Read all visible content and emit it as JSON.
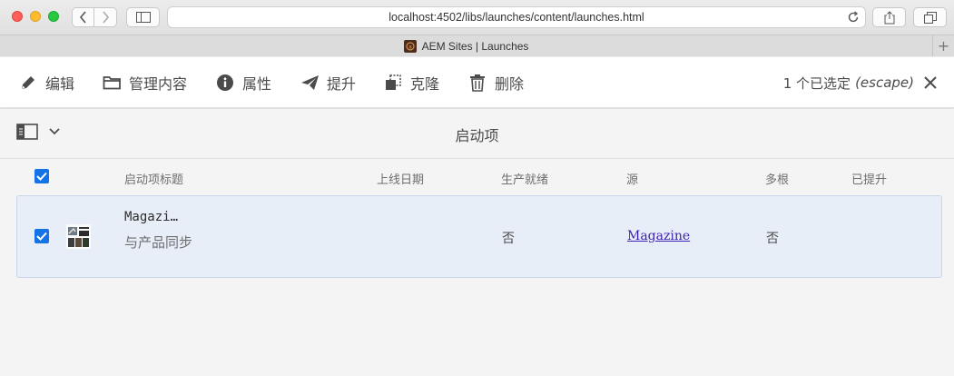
{
  "browser": {
    "url": "localhost:4502/libs/launches/content/launches.html",
    "tab_title": "AEM Sites | Launches",
    "new_tab_label": "+"
  },
  "actions": [
    {
      "label": "编辑",
      "icon": "pencil-icon"
    },
    {
      "label": "管理内容",
      "icon": "folder-icon"
    },
    {
      "label": "属性",
      "icon": "info-icon"
    },
    {
      "label": "提升",
      "icon": "send-icon"
    },
    {
      "label": "克隆",
      "icon": "duplicate-icon"
    },
    {
      "label": "删除",
      "icon": "trash-icon"
    }
  ],
  "selection": {
    "count_label": "1 个已选定",
    "escape_label": "(escape)"
  },
  "page": {
    "title": "启动项"
  },
  "table": {
    "columns": [
      "启动项标题",
      "上线日期",
      "生产就绪",
      "源",
      "多根",
      "已提升"
    ],
    "rows": [
      {
        "title": "Magazi…",
        "subtitle": "与产品同步",
        "live_date": "",
        "production_ready": "否",
        "source": "Magazine",
        "multi_root": "否",
        "promoted": "",
        "selected": true
      }
    ]
  },
  "colors": {
    "accent": "#1473e6",
    "row_selected": "#e8eef8",
    "text": "#4b4b4b"
  }
}
